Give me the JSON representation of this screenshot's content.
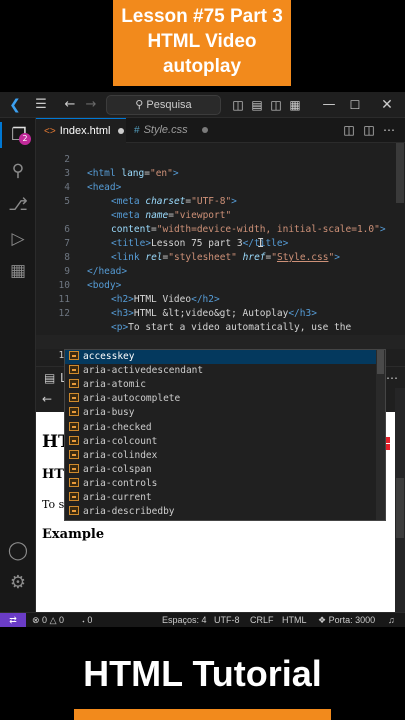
{
  "banner": {
    "line1": "Lesson #75 Part 3",
    "line2": "HTML Video",
    "line3": "autoplay",
    "color": "#f28a1c"
  },
  "titlebar": {
    "logo_icon": "vscode-logo-icon",
    "menu_icon": "hamburger-menu-icon",
    "back_icon": "arrow-left-icon",
    "forward_icon": "arrow-right-icon",
    "search_placeholder": "Pesquisa",
    "search_icon": "search-icon",
    "layout_icons": [
      "toggle-sidebar-icon",
      "toggle-panel-icon",
      "toggle-secondary-sidebar-icon",
      "customize-layout-icon"
    ],
    "window_controls": [
      "minimize-icon",
      "maximize-icon",
      "close-icon"
    ]
  },
  "activity_bar": {
    "items": [
      "explorer-icon",
      "search-icon",
      "source-control-icon",
      "run-debug-icon",
      "extensions-icon"
    ],
    "explorer_badge": "2",
    "bottom": [
      "account-icon",
      "settings-gear-icon"
    ]
  },
  "tabs": [
    {
      "label": "Index.html",
      "icon": "html-file-icon",
      "modified": true,
      "active": true
    },
    {
      "label": "Style.css",
      "icon": "css-file-icon",
      "modified": true,
      "active": false
    }
  ],
  "editor": {
    "lines": [
      {
        "n": "2"
      },
      {
        "n": "3"
      },
      {
        "n": "4"
      },
      {
        "n": "5"
      },
      {
        "n": "6"
      },
      {
        "n": "7"
      },
      {
        "n": "8"
      },
      {
        "n": "9"
      },
      {
        "n": "10"
      },
      {
        "n": "11"
      },
      {
        "n": "12"
      },
      {
        "n": ""
      },
      {
        "n": "13"
      },
      {
        "n": "14"
      }
    ]
  },
  "suggestions": {
    "items": [
      "accesskey",
      "aria-activedescendant",
      "aria-atomic",
      "aria-autocomplete",
      "aria-busy",
      "aria-checked",
      "aria-colcount",
      "aria-colindex",
      "aria-colspan",
      "aria-controls",
      "aria-current",
      "aria-describedby"
    ],
    "selected_index": 0
  },
  "preview": {
    "h2": "HTML",
    "h3": "HTML",
    "p": "To s",
    "example": "Example"
  },
  "statusbar": {
    "remote_icon": "remote-icon",
    "errors": "0",
    "warnings": "0",
    "ports": "0",
    "spaces": "Espaços: 4",
    "encoding": "UTF-8",
    "eol": "CRLF",
    "language": "HTML",
    "port": "Porta: 3000"
  },
  "footer": {
    "title": "HTML Tutorial"
  }
}
